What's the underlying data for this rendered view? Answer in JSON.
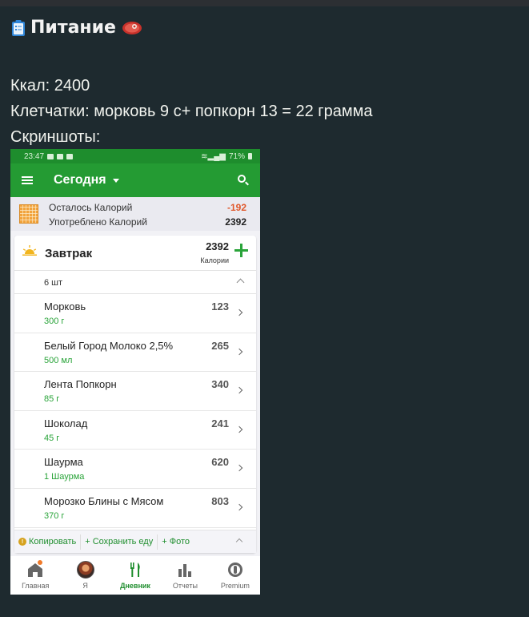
{
  "note": {
    "title": "Питание",
    "title_icon_left": "clipboard-icon",
    "title_icon_right": "meat-icon",
    "lines": [
      "Ккал: 2400",
      "Клетчатки: морковь 9 с+ попкорн 13 = 22 грамма",
      "Скриншоты:"
    ]
  },
  "phone": {
    "status": {
      "time": "23:47",
      "battery": "71%"
    },
    "appbar": {
      "title": "Сегодня"
    },
    "summary": {
      "remaining_label": "Осталось Калорий",
      "remaining_value": "-192",
      "consumed_label": "Употреблено Калорий",
      "consumed_value": "2392"
    },
    "meal": {
      "name": "Завтрак",
      "kcal": "2392",
      "kcal_label": "Калории",
      "count": "6 шт",
      "items": [
        {
          "name": "Морковь",
          "qty": "300 г",
          "kcal": "123"
        },
        {
          "name": "Белый Город Молоко 2,5%",
          "qty": "500 мл",
          "kcal": "265"
        },
        {
          "name": "Лента Попкорн",
          "qty": "85 г",
          "kcal": "340"
        },
        {
          "name": "Шоколад",
          "qty": "45 г",
          "kcal": "241"
        },
        {
          "name": "Шаурма",
          "qty": "1 Шаурма",
          "kcal": "620"
        },
        {
          "name": "Морозко Блины с Мясом",
          "qty": "370 г",
          "kcal": "803"
        }
      ]
    },
    "actions": {
      "copy": "Копировать",
      "save": "+ Сохранить еду",
      "photo": "+ Фото"
    },
    "nav": {
      "home": "Главная",
      "me": "Я",
      "diary": "Дневник",
      "reports": "Отчеты",
      "premium": "Premium"
    },
    "colors": {
      "accent": "#249b33",
      "negative": "#e0582b"
    }
  }
}
